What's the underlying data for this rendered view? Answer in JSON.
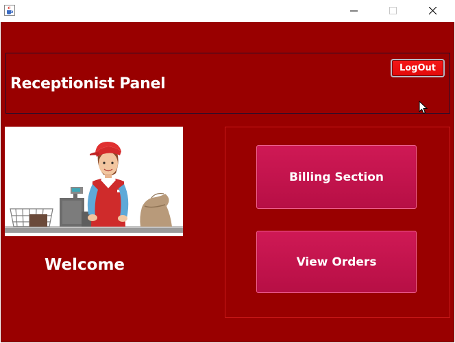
{
  "window": {
    "title": "",
    "icons": {
      "app": "java-cup-icon",
      "minimize": "minimize-icon",
      "maximize": "maximize-icon",
      "close": "close-icon"
    }
  },
  "header": {
    "title": "Receptionist Panel",
    "logout_label": "LogOut"
  },
  "welcome": {
    "text": "Welcome"
  },
  "nav": {
    "billing_label": "Billing Section",
    "orders_label": "View Orders"
  },
  "colors": {
    "background": "#990000",
    "logout": "#f01414",
    "nav_button": "#c4124d",
    "text": "#ffffff"
  }
}
